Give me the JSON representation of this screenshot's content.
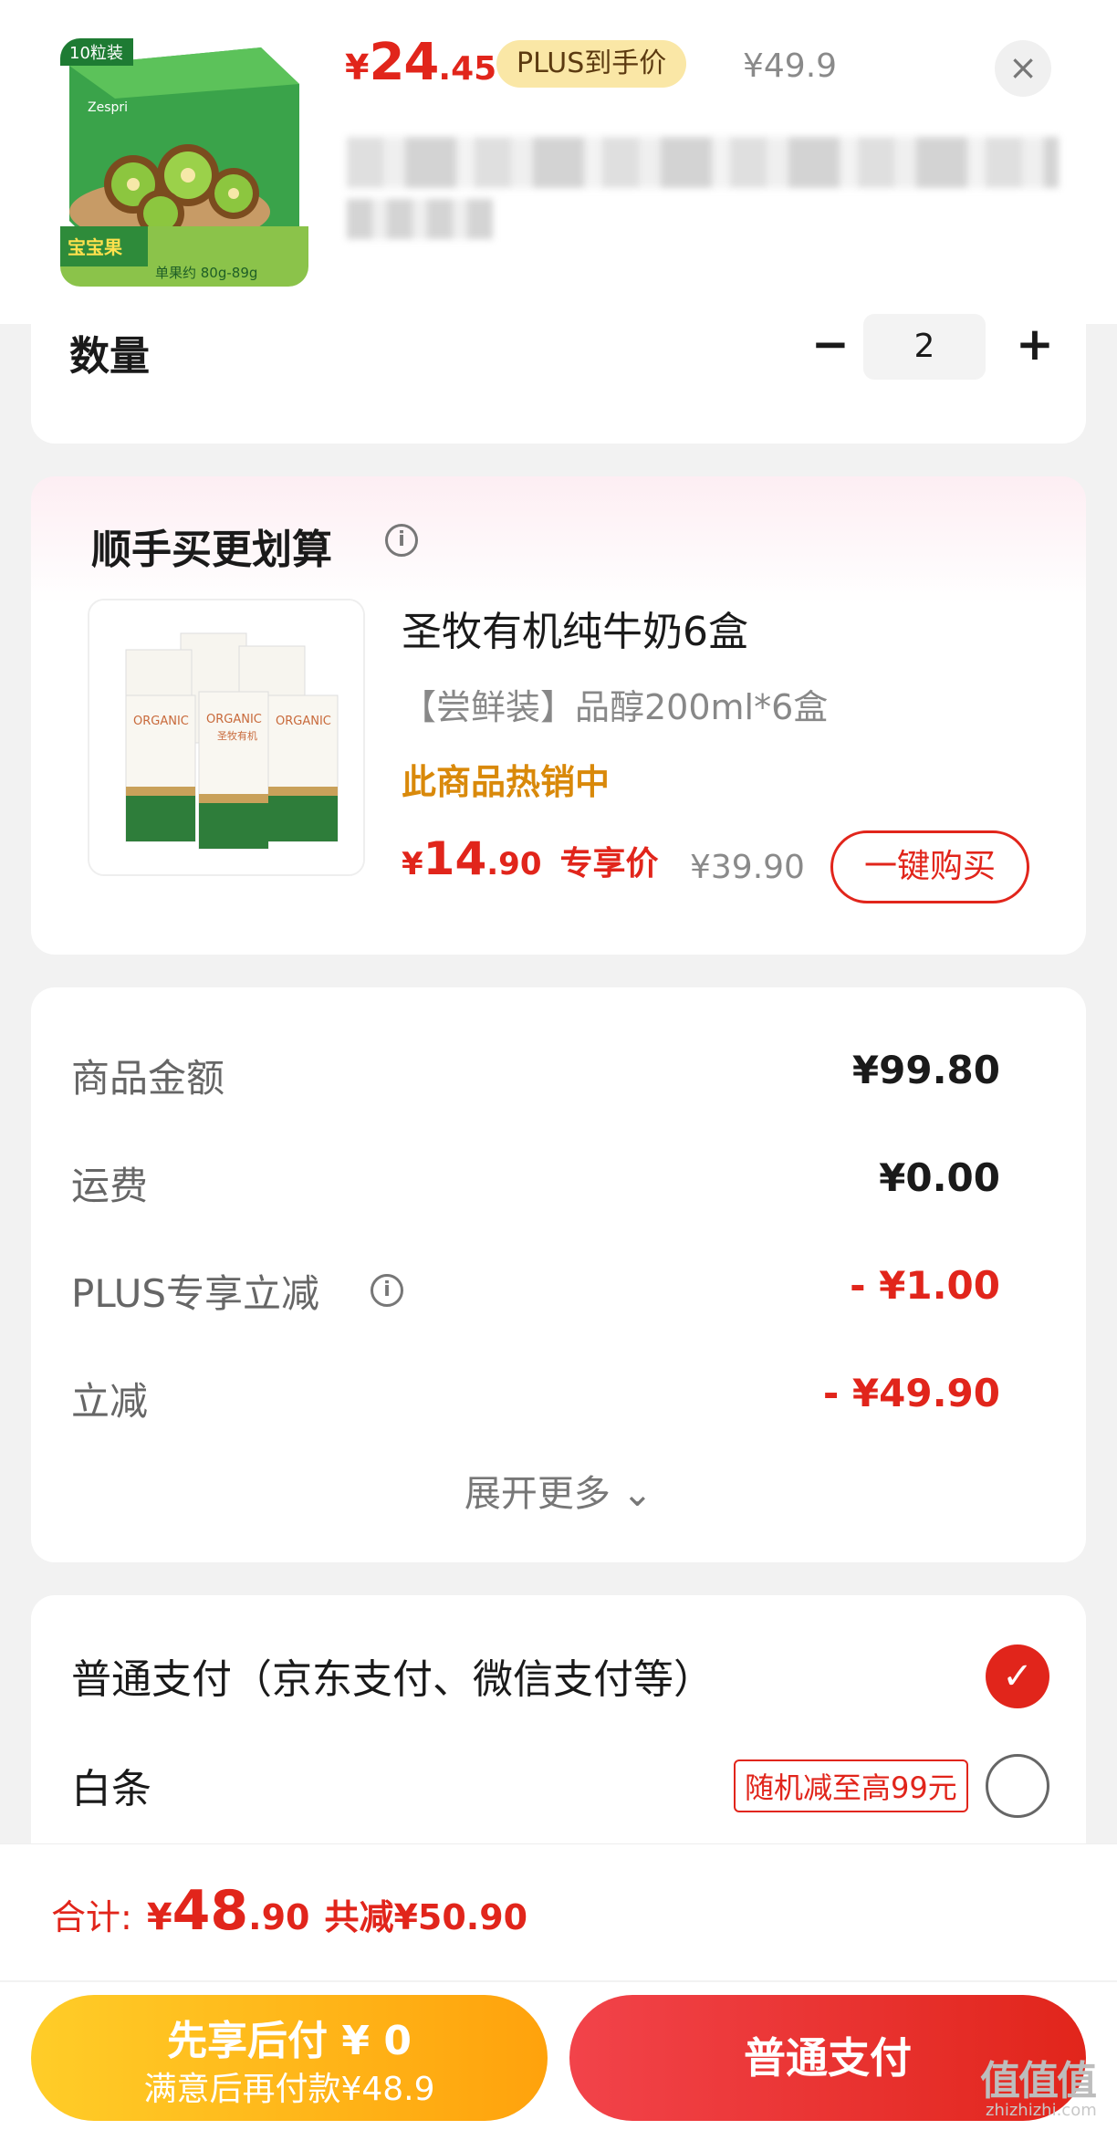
{
  "header": {
    "product_image_badge_top": "10粒装",
    "product_image_badge_bottom": "宝宝果",
    "product_image_note": "单果约 80g-89g",
    "product_image_brand": "Zespri",
    "price_yen": "¥",
    "price_int": "24",
    "price_dec": ".45",
    "plus_tag": "PLUS到手价",
    "orig_price": "¥49.9",
    "close_icon": "×"
  },
  "quantity": {
    "label": "数量",
    "minus": "−",
    "value": "2",
    "plus": "+"
  },
  "upsell": {
    "title": "顺手买更划算",
    "info_icon": "i",
    "product_name": "圣牧有机纯牛奶6盒",
    "product_spec": "【尝鲜装】品醇200ml*6盒",
    "hot_text": "此商品热销中",
    "price_yen": "¥",
    "price_int": "14",
    "price_dec": ".90",
    "price_tag": "专享价",
    "orig_price": "¥39.90",
    "buy_button": "一键购买",
    "milk_box_text": "ORGANIC",
    "milk_box_sub": "圣牧有机"
  },
  "summary": {
    "rows": [
      {
        "label": "商品金额",
        "value": "¥99.80"
      },
      {
        "label": "运费",
        "value": "¥0.00"
      },
      {
        "label": "PLUS专享立减",
        "value": "- ¥1.00"
      },
      {
        "label": "立减",
        "value": "- ¥49.90"
      }
    ],
    "expand": "展开更多 ⌄"
  },
  "payment": {
    "option1": "普通支付（京东支付、微信支付等）",
    "option1_check": "✓",
    "option2": "白条",
    "option2_promo": "随机减至高99元"
  },
  "total": {
    "label": "合计:",
    "yen": "¥",
    "int": "48",
    "dec": ".90",
    "saved": "共减¥50.90"
  },
  "buttons": {
    "later_line1": "先享后付 ¥ 0",
    "later_line2": "满意后再付款¥48.9",
    "pay": "普通支付"
  },
  "watermark": {
    "text": "值值值",
    "sub": "zhizhizhi.com"
  },
  "colors": {
    "accent_red": "#e1251b",
    "plus_gold": "#fae7a6",
    "hot_orange": "#d9890a",
    "later_button": "#ffa20c"
  }
}
